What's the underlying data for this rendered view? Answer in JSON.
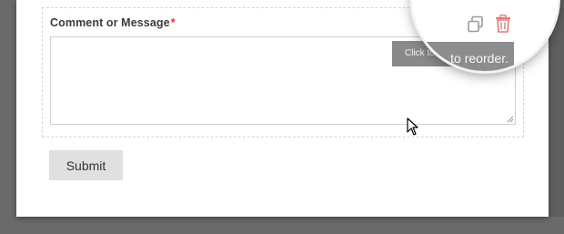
{
  "form": {
    "field_label": "Comment or Message",
    "required_marker": "*",
    "textarea_value": "",
    "submit_label": "Submit"
  },
  "tooltip": {
    "small_text": "Click to edit.",
    "zoomed_text": "to reorder."
  },
  "icons": {
    "duplicate": "duplicate-icon",
    "delete": "trash-icon",
    "cursor": "mouse-pointer-icon",
    "resize": "resize-handle-icon"
  },
  "colors": {
    "required": "#d63638",
    "delete_icon": "#e07a7a",
    "tooltip_bg": "#8a8a8a",
    "button_bg": "#e0e0e0"
  }
}
